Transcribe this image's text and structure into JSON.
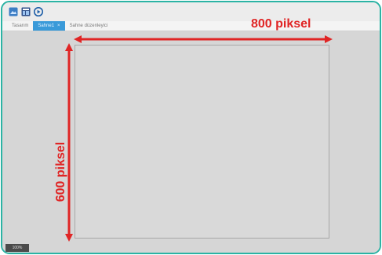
{
  "toolbar": {
    "buttons": [
      {
        "icon": "image-icon",
        "color": "#3b7dc4"
      },
      {
        "icon": "window-icon",
        "color": "#2f4f8a"
      },
      {
        "icon": "play-icon",
        "color": "#1f5fa8"
      }
    ]
  },
  "tabs": [
    {
      "label": "Tasarım",
      "active": false
    },
    {
      "label": "Sahne1",
      "close": "×",
      "active": true
    },
    {
      "label": "Sahne düzenleyici",
      "active": false
    }
  ],
  "canvas_annotations": {
    "width_label": "800 piksel",
    "height_label": "600 piksel",
    "arrow_color": "#e02525"
  },
  "status": {
    "text": "100%"
  },
  "colors": {
    "frame": "#2bb3a4",
    "active_tab": "#3a9ad9"
  }
}
